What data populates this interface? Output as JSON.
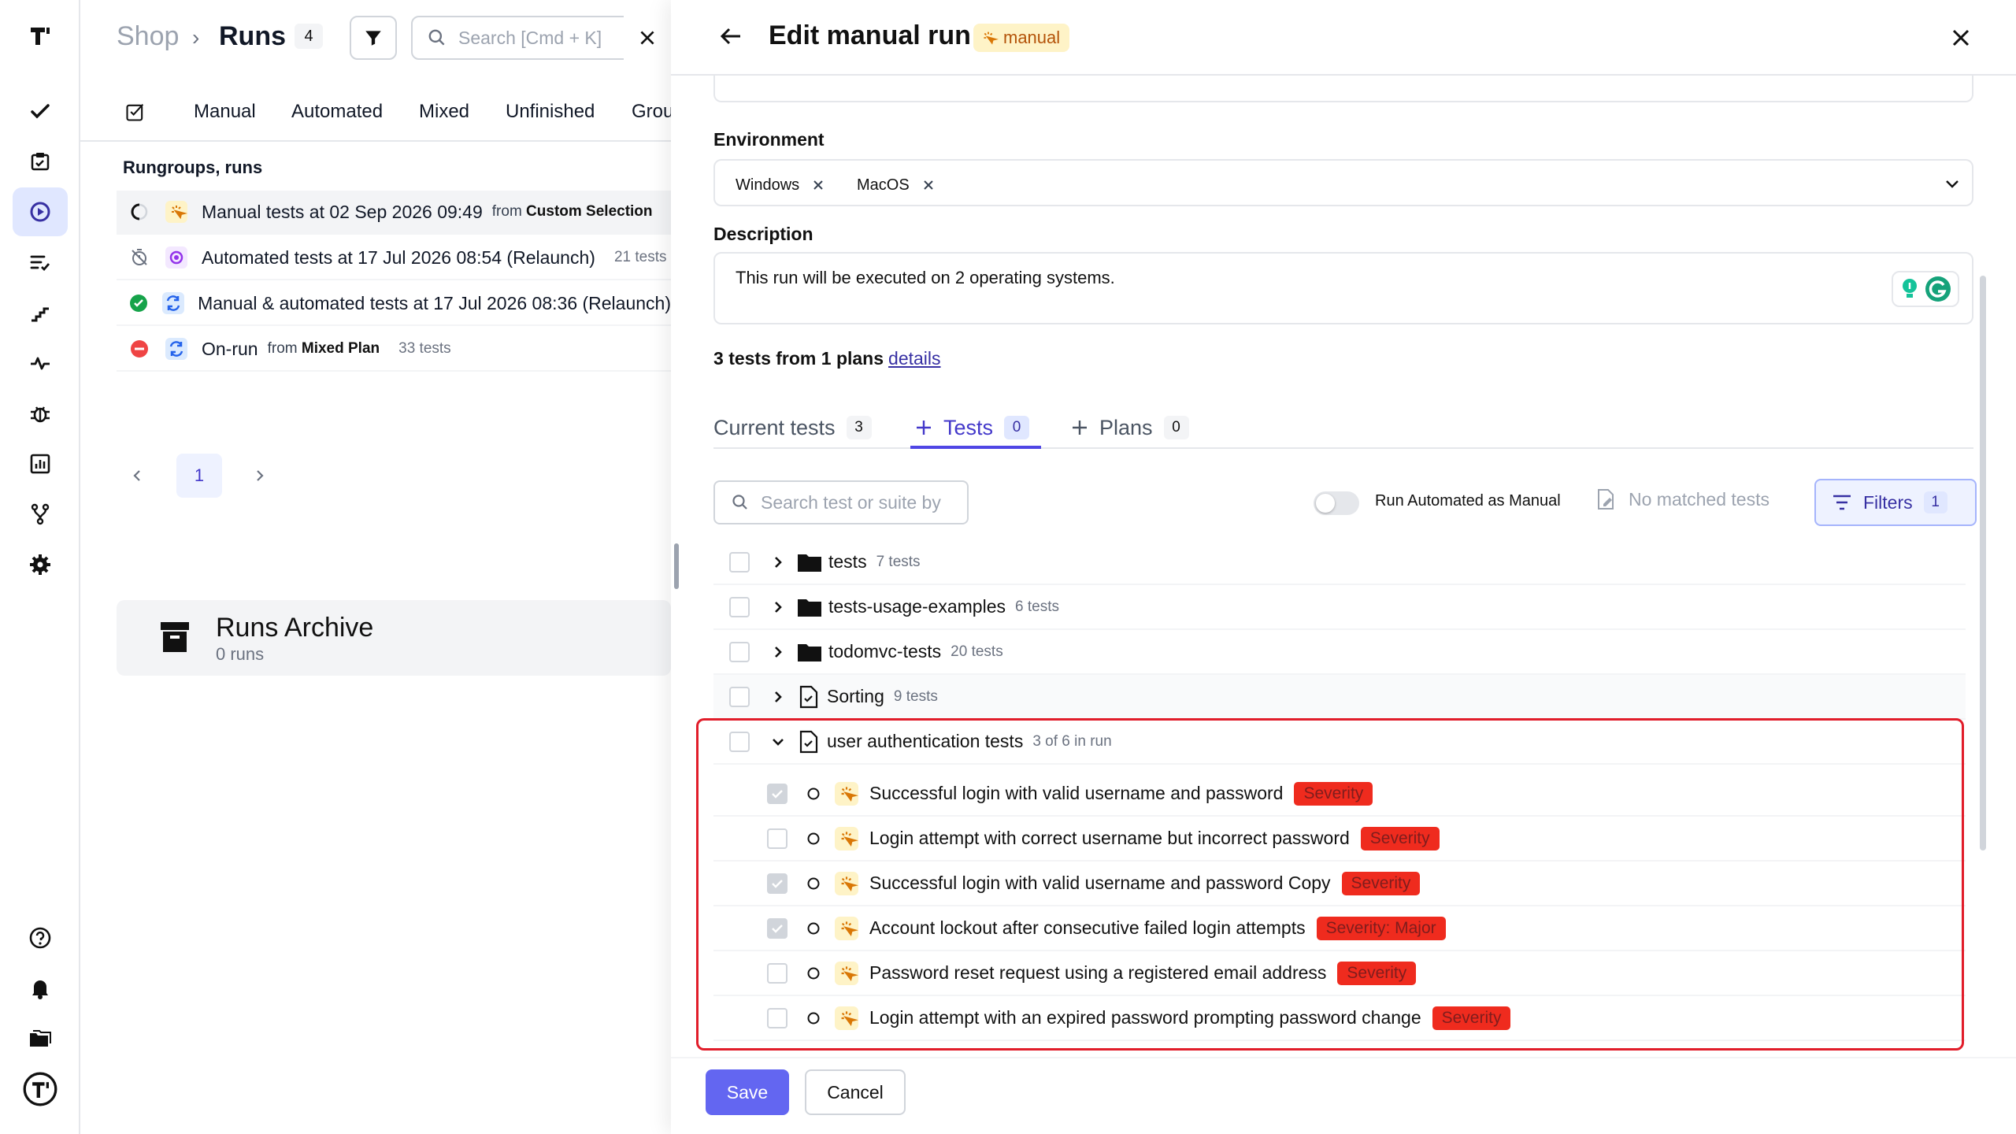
{
  "colors": {
    "accent": "#6366f1",
    "danger": "#ef2b1e",
    "success": "#16a34a",
    "highlight": "#e11d2a"
  },
  "rail": {
    "items": [
      "logo-icon",
      "check-icon",
      "clipboard-icon",
      "play-icon",
      "list-check-icon",
      "stairs-icon",
      "pulse-icon",
      "bug-icon",
      "chart-icon",
      "branch-icon",
      "gear-icon",
      "help-icon",
      "bell-icon",
      "folders-icon",
      "brand-icon"
    ]
  },
  "runs": {
    "breadcrumb": {
      "project": "Shop",
      "separator": "›",
      "page": "Runs",
      "count": "4"
    },
    "search_placeholder": "Search [Cmd + K]",
    "tabs": [
      "Manual",
      "Automated",
      "Mixed",
      "Unfinished",
      "Grou"
    ],
    "section_title": "Rungroups, runs",
    "rows": [
      {
        "title": "Manual tests at 02 Sep 2026 09:49",
        "from_label": "from",
        "from": "Custom Selection",
        "count": ""
      },
      {
        "title": "Automated tests at 17 Jul 2026 08:54 (Relaunch)",
        "from_label": "",
        "from": "",
        "count": "21 tests"
      },
      {
        "title": "Manual & automated tests at 17 Jul 2026 08:36 (Relaunch)",
        "from_label": "",
        "from": "",
        "count": ""
      },
      {
        "title": "On-run",
        "from_label": "from",
        "from": "Mixed Plan",
        "count": "33 tests"
      }
    ],
    "pagination": {
      "current": "1"
    },
    "archive": {
      "title": "Runs Archive",
      "subtitle": "0 runs"
    }
  },
  "edit": {
    "title": "Edit manual run",
    "badge": "manual",
    "environment_label": "Environment",
    "environments": [
      "Windows",
      "MacOS"
    ],
    "description_label": "Description",
    "description": "This run will be executed on 2 operating systems.",
    "summary": {
      "count": "3",
      "text": "tests from 1 plans",
      "link": "details"
    },
    "tabs": [
      {
        "label": "Current tests",
        "count": "3"
      },
      {
        "label": "Tests",
        "count": "0"
      },
      {
        "label": "Plans",
        "count": "0"
      }
    ],
    "search_placeholder": "Search test or suite by",
    "toggle_label": "Run Automated as Manual",
    "no_matched": "No matched tests",
    "filters": {
      "label": "Filters",
      "count": "1"
    },
    "tree": [
      {
        "name": "tests",
        "meta": "7 tests"
      },
      {
        "name": "tests-usage-examples",
        "meta": "6 tests"
      },
      {
        "name": "todomvc-tests",
        "meta": "20 tests"
      },
      {
        "name": "Sorting",
        "meta": "9 tests"
      },
      {
        "name": "user authentication tests",
        "meta": "3 of 6 in run"
      }
    ],
    "tests": [
      {
        "name": "Successful login with valid username and password",
        "tag": "Severity",
        "checked": true
      },
      {
        "name": "Login attempt with correct username but incorrect password",
        "tag": "Severity",
        "checked": false
      },
      {
        "name": "Successful login with valid username and password Copy",
        "tag": "Severity",
        "checked": true
      },
      {
        "name": "Account lockout after consecutive failed login attempts",
        "tag": "Severity: Major",
        "checked": true
      },
      {
        "name": "Password reset request using a registered email address",
        "tag": "Severity",
        "checked": false
      },
      {
        "name": "Login attempt with an expired password prompting password change",
        "tag": "Severity",
        "checked": false
      }
    ],
    "save": "Save",
    "cancel": "Cancel"
  }
}
